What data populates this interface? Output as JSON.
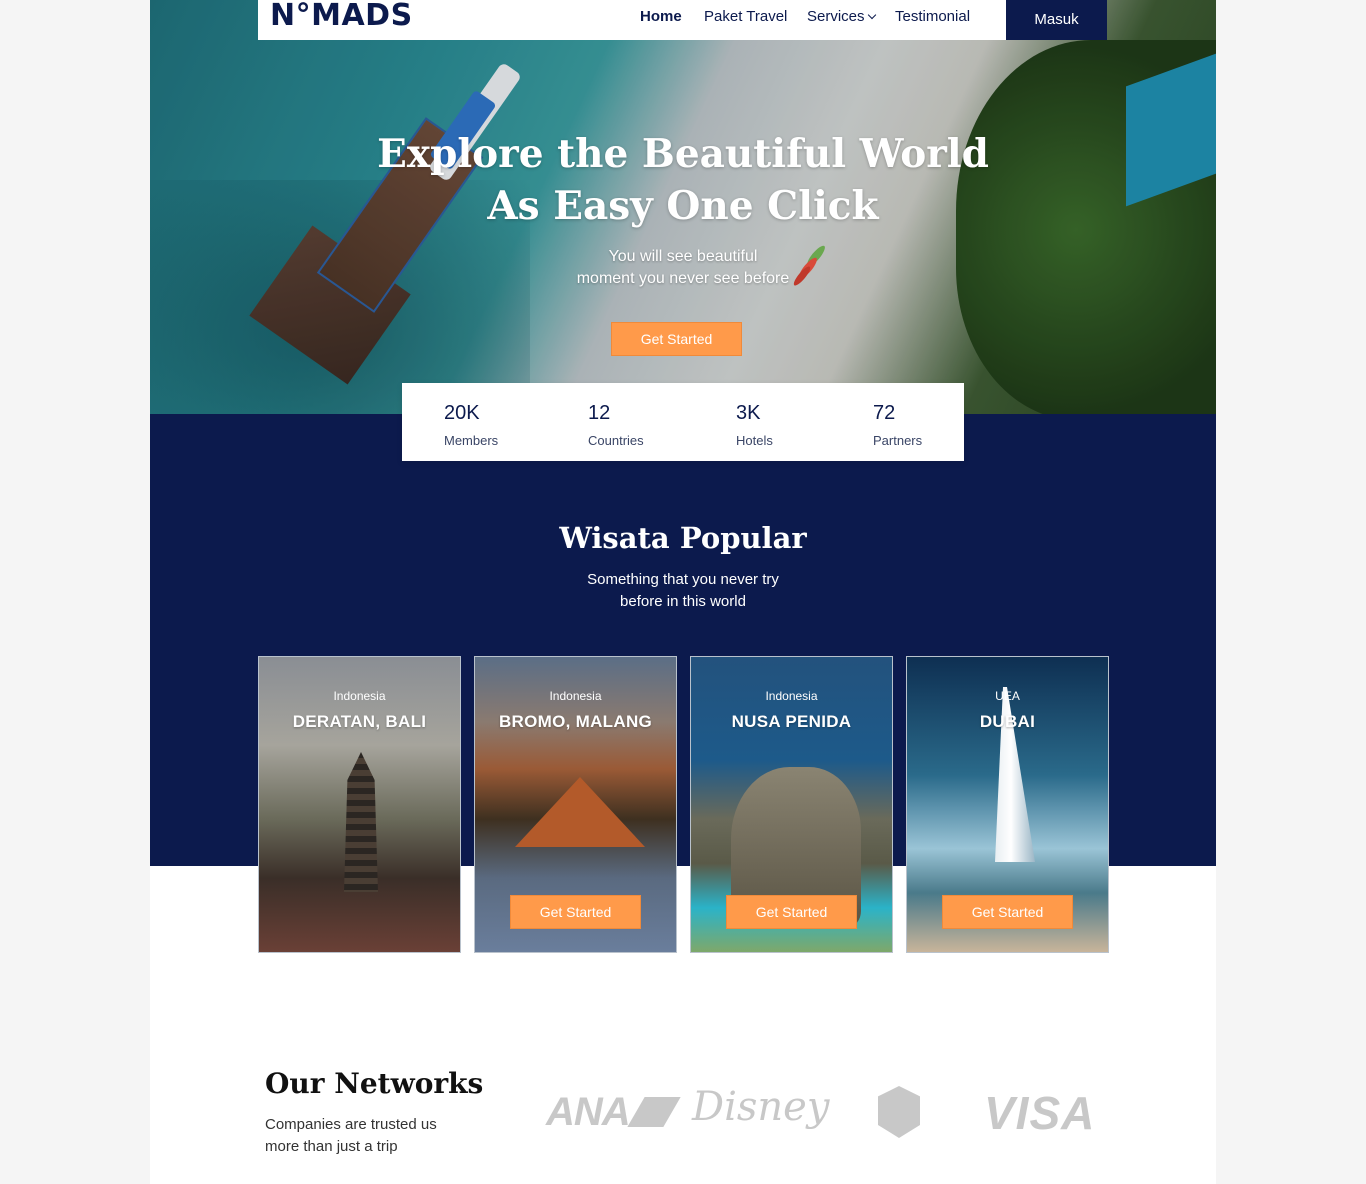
{
  "nav": {
    "logo": "N°MADS",
    "links": [
      "Home",
      "Paket Travel",
      "Services",
      "Testimonial"
    ],
    "login_label": "Masuk"
  },
  "hero": {
    "title_line1": "Explore the Beautiful World",
    "title_line2": "As Easy One Click",
    "subtitle_line1": "You will see beautiful",
    "subtitle_line2": "moment you never see before",
    "cta_label": "Get Started"
  },
  "stats": [
    {
      "value": "20K",
      "label": "Members"
    },
    {
      "value": "12",
      "label": "Countries"
    },
    {
      "value": "3K",
      "label": "Hotels"
    },
    {
      "value": "72",
      "label": "Partners"
    }
  ],
  "popular": {
    "title": "Wisata Popular",
    "subtitle_line1": "Something that you never try",
    "subtitle_line2": "before in this world",
    "cards": [
      {
        "country": "Indonesia",
        "name": "DERATAN, BALI",
        "cta": ""
      },
      {
        "country": "Indonesia",
        "name": "BROMO, MALANG",
        "cta": "Get Started"
      },
      {
        "country": "Indonesia",
        "name": "NUSA PENIDA",
        "cta": "Get Started"
      },
      {
        "country": "UEA",
        "name": "DUBAI",
        "cta": "Get Started"
      }
    ]
  },
  "networks": {
    "title": "Our Networks",
    "subtitle_line1": "Companies are trusted us",
    "subtitle_line2": "more than just a trip",
    "brands": [
      "ANA",
      "Disney",
      "VISA"
    ]
  },
  "colors": {
    "navy": "#0c1a4d",
    "orange": "#ff9a4a",
    "brand_gray": "#c8c8c8"
  }
}
